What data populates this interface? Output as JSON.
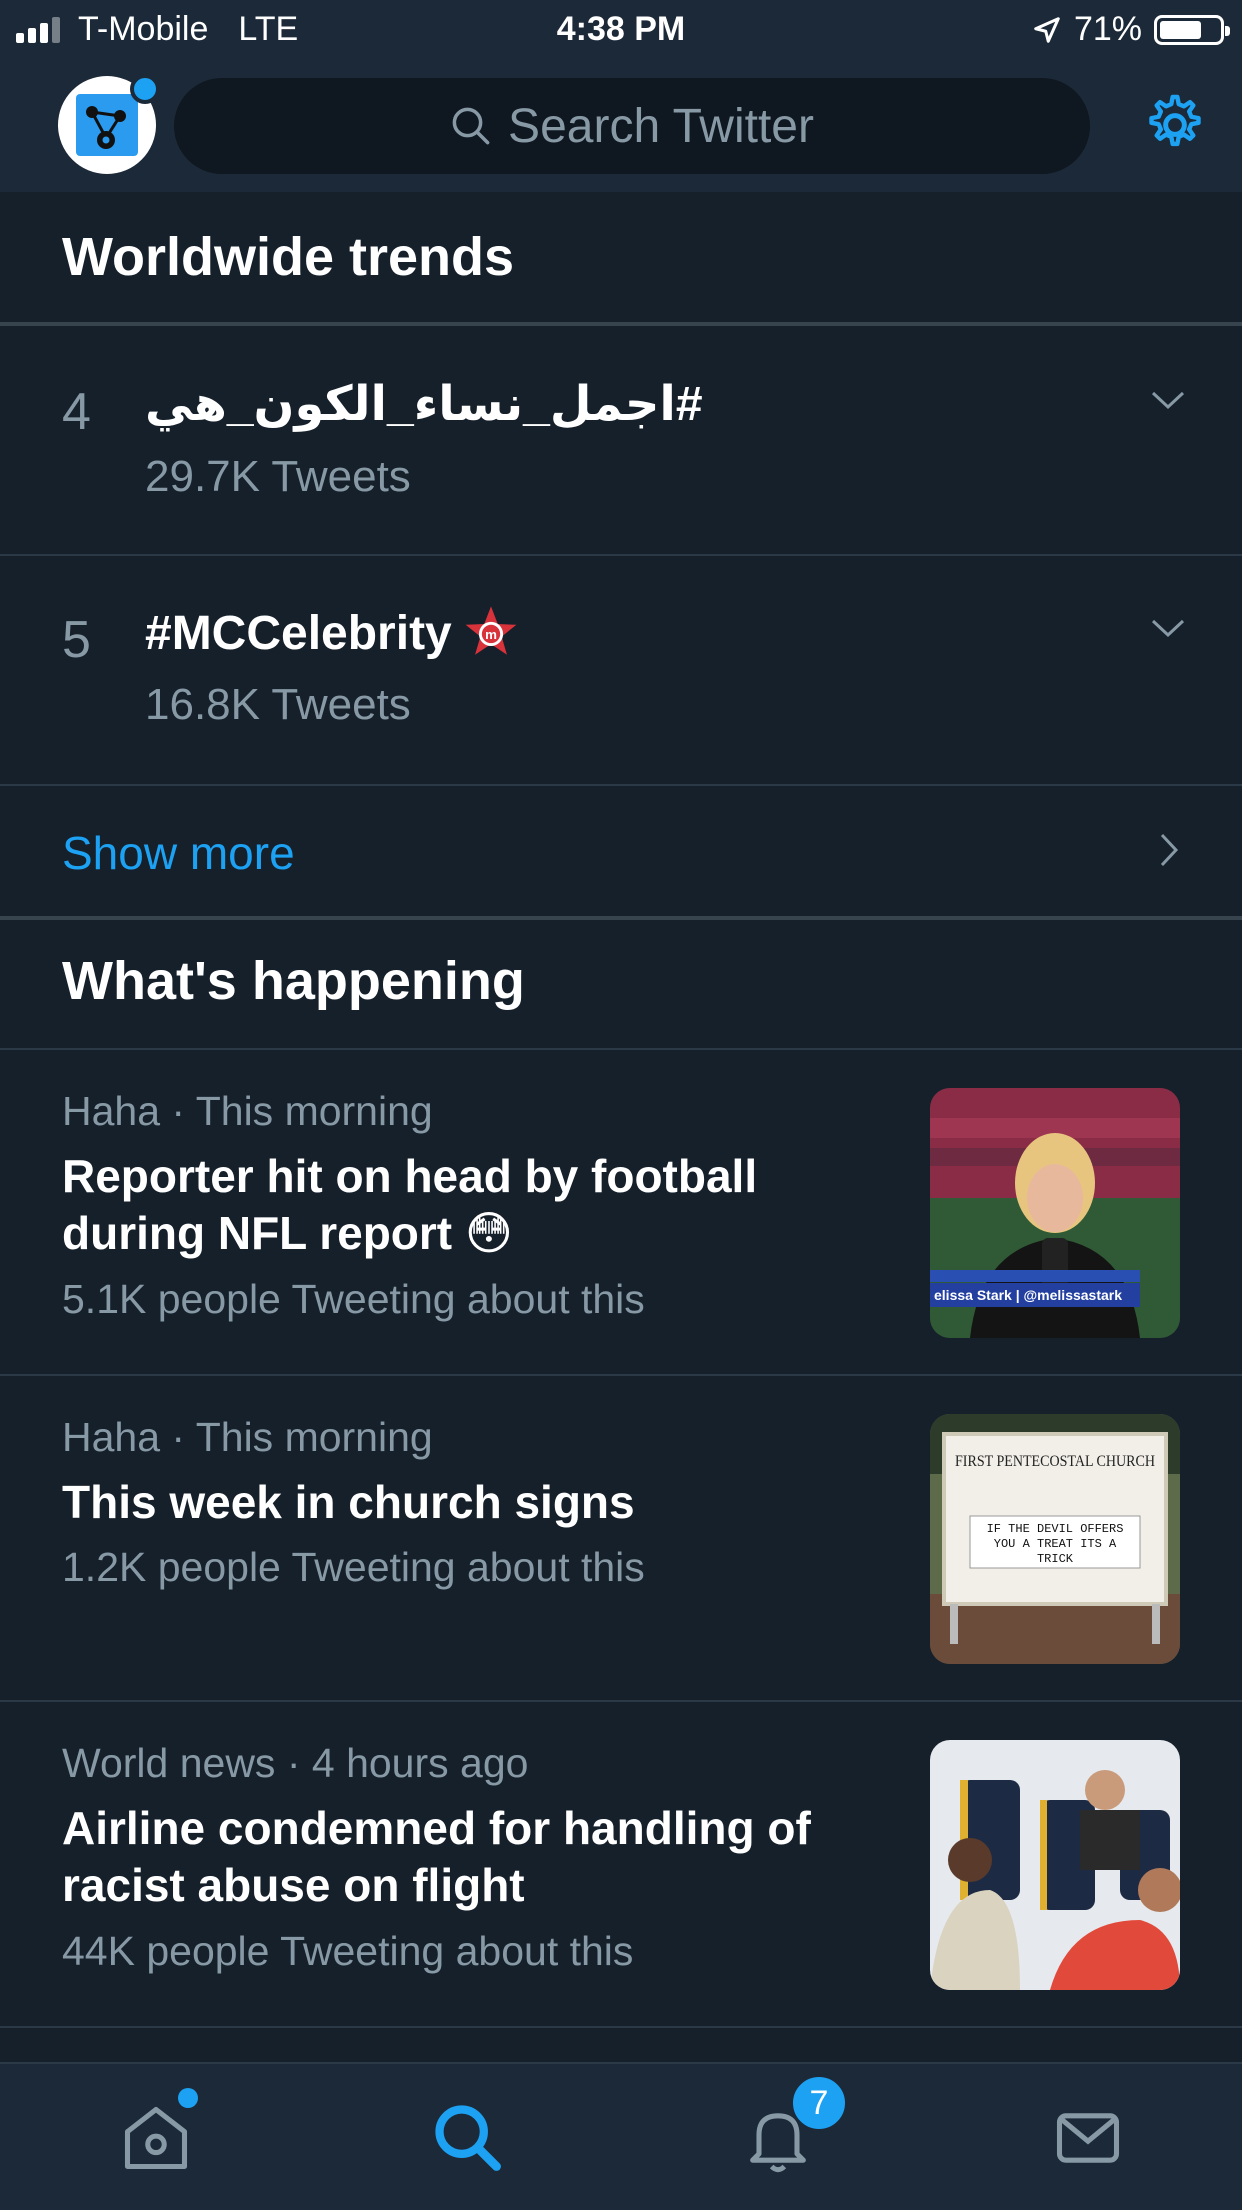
{
  "status_bar": {
    "carrier": "T-Mobile",
    "network": "LTE",
    "time": "4:38 PM",
    "battery": "71%",
    "battery_level": 0.71
  },
  "header": {
    "search_placeholder": "Search Twitter",
    "icons": [
      "avatar",
      "search-icon",
      "gear-icon"
    ]
  },
  "worldwide": {
    "title": "Worldwide trends",
    "trends": [
      {
        "rank": "4",
        "name": "#اجمل_نساء_الكون_هي",
        "count": "29.7K Tweets"
      },
      {
        "rank": "5",
        "name": "#MCCelebrity",
        "count": "16.8K Tweets"
      }
    ],
    "show_more": "Show more"
  },
  "happening": {
    "title": "What's happening",
    "items": [
      {
        "category": "Haha",
        "time": "This morning",
        "headline": "Reporter hit on head by football during NFL report 😳",
        "tweets": "5.1K people Tweeting about this"
      },
      {
        "category": "Haha",
        "time": "This morning",
        "headline": "This week in church signs",
        "tweets": "1.2K people Tweeting about this"
      },
      {
        "category": "World news",
        "time": "4 hours ago",
        "headline": "Airline condemned for handling of racist abuse on flight",
        "tweets": "44K people Tweeting about this"
      }
    ],
    "thumb_text": {
      "reporter_banner": "elissa Stark | @melissastark",
      "sign_title": "FIRST PENTECOSTAL CHURCH",
      "sign_message": "IF THE DEVIL OFFERS YOU A TREAT ITS A TRICK"
    }
  },
  "tab_bar": {
    "notifications_badge": "7",
    "icons": [
      "home-icon",
      "search-icon",
      "notifications-icon",
      "messages-icon"
    ]
  },
  "colors": {
    "accent": "#1da1f2",
    "background": "#15202b",
    "bar": "#1c2938",
    "secondary_text": "#8899a6"
  }
}
